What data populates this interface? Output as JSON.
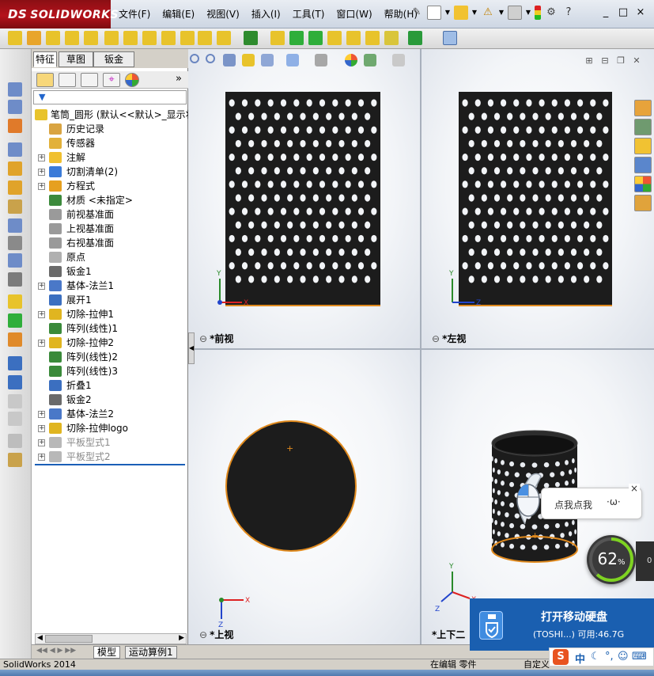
{
  "app": {
    "logo_prefix": "DS",
    "logo_text": "SOLIDWORKS",
    "menus": [
      "文件(F)",
      "编辑(E)",
      "视图(V)",
      "插入(I)",
      "工具(T)",
      "窗口(W)",
      "帮助(H)"
    ],
    "window_buttons": [
      "_",
      "□",
      "×"
    ]
  },
  "feature_manager": {
    "tabs": [
      "特征",
      "草图",
      "钣金"
    ],
    "expand_label": "»",
    "root_label": "笔筒_圆形  (默认<<默认>_显示状",
    "tree": [
      {
        "label": "历史记录",
        "expandable": false,
        "dim": false,
        "icon_color": "#d9a441"
      },
      {
        "label": "传感器",
        "expandable": false,
        "dim": false,
        "icon_color": "#e2b13a"
      },
      {
        "label": "注解",
        "expandable": true,
        "dim": false,
        "icon_color": "#f0c030"
      },
      {
        "label": "切割清单(2)",
        "expandable": true,
        "dim": false,
        "icon_color": "#3b7bd8"
      },
      {
        "label": "方程式",
        "expandable": true,
        "dim": false,
        "icon_color": "#e6a020"
      },
      {
        "label": "材质 <未指定>",
        "expandable": false,
        "dim": false,
        "icon_color": "#3c8a3c"
      },
      {
        "label": "前视基准面",
        "expandable": false,
        "dim": false,
        "icon_color": "#9a9a9a"
      },
      {
        "label": "上视基准面",
        "expandable": false,
        "dim": false,
        "icon_color": "#9a9a9a"
      },
      {
        "label": "右视基准面",
        "expandable": false,
        "dim": false,
        "icon_color": "#9a9a9a"
      },
      {
        "label": "原点",
        "expandable": false,
        "dim": false,
        "icon_color": "#b0b0b0"
      },
      {
        "label": "钣金1",
        "expandable": false,
        "dim": false,
        "icon_color": "#6a6a6a"
      },
      {
        "label": "基体-法兰1",
        "expandable": true,
        "dim": false,
        "icon_color": "#4a78c8"
      },
      {
        "label": "展开1",
        "expandable": false,
        "dim": false,
        "icon_color": "#3b6fc0"
      },
      {
        "label": "切除-拉伸1",
        "expandable": true,
        "dim": false,
        "icon_color": "#e0b520"
      },
      {
        "label": "阵列(线性)1",
        "expandable": false,
        "dim": false,
        "icon_color": "#3a8a3a"
      },
      {
        "label": "切除-拉伸2",
        "expandable": true,
        "dim": false,
        "icon_color": "#e0b520"
      },
      {
        "label": "阵列(线性)2",
        "expandable": false,
        "dim": false,
        "icon_color": "#3a8a3a"
      },
      {
        "label": "阵列(线性)3",
        "expandable": false,
        "dim": false,
        "icon_color": "#3a8a3a"
      },
      {
        "label": "折叠1",
        "expandable": false,
        "dim": false,
        "icon_color": "#3b6fc0"
      },
      {
        "label": "钣金2",
        "expandable": false,
        "dim": false,
        "icon_color": "#6a6a6a"
      },
      {
        "label": "基体-法兰2",
        "expandable": true,
        "dim": false,
        "icon_color": "#4a78c8"
      },
      {
        "label": "切除-拉伸logo",
        "expandable": true,
        "dim": false,
        "icon_color": "#e0b520"
      },
      {
        "label": "平板型式1",
        "expandable": true,
        "dim": true,
        "icon_color": "#b8b8b8"
      },
      {
        "label": "平板型式2",
        "expandable": true,
        "dim": true,
        "icon_color": "#b8b8b8"
      }
    ]
  },
  "viewports": {
    "front": {
      "label": "*前视"
    },
    "left": {
      "label": "*左视"
    },
    "top": {
      "label": "*上视"
    },
    "iso": {
      "label": "*上下二"
    }
  },
  "axes": {
    "x": "X",
    "y": "Y",
    "z": "Z"
  },
  "bottom_tabs": [
    "模型",
    "运动算例1"
  ],
  "status": {
    "app": "SolidWorks 2014",
    "editing": "在编辑 零件",
    "custom": "自定义"
  },
  "popups": {
    "bubble_text": "点我点我",
    "bubble_face": "·ω·",
    "bubble_close": "×",
    "gauge_value": "62",
    "gauge_unit": "%",
    "gauge_side": "0",
    "usb_title": "打开移动硬盘",
    "usb_detail": "(TOSHI...)  可用:46.7G"
  },
  "ime": {
    "logo": "S",
    "lang": "中"
  },
  "colors": {
    "brand_red": "#b5121b",
    "part_black": "#1c1c1c",
    "edge_orange": "#e08a1e",
    "accent_blue": "#1a5fb0"
  }
}
